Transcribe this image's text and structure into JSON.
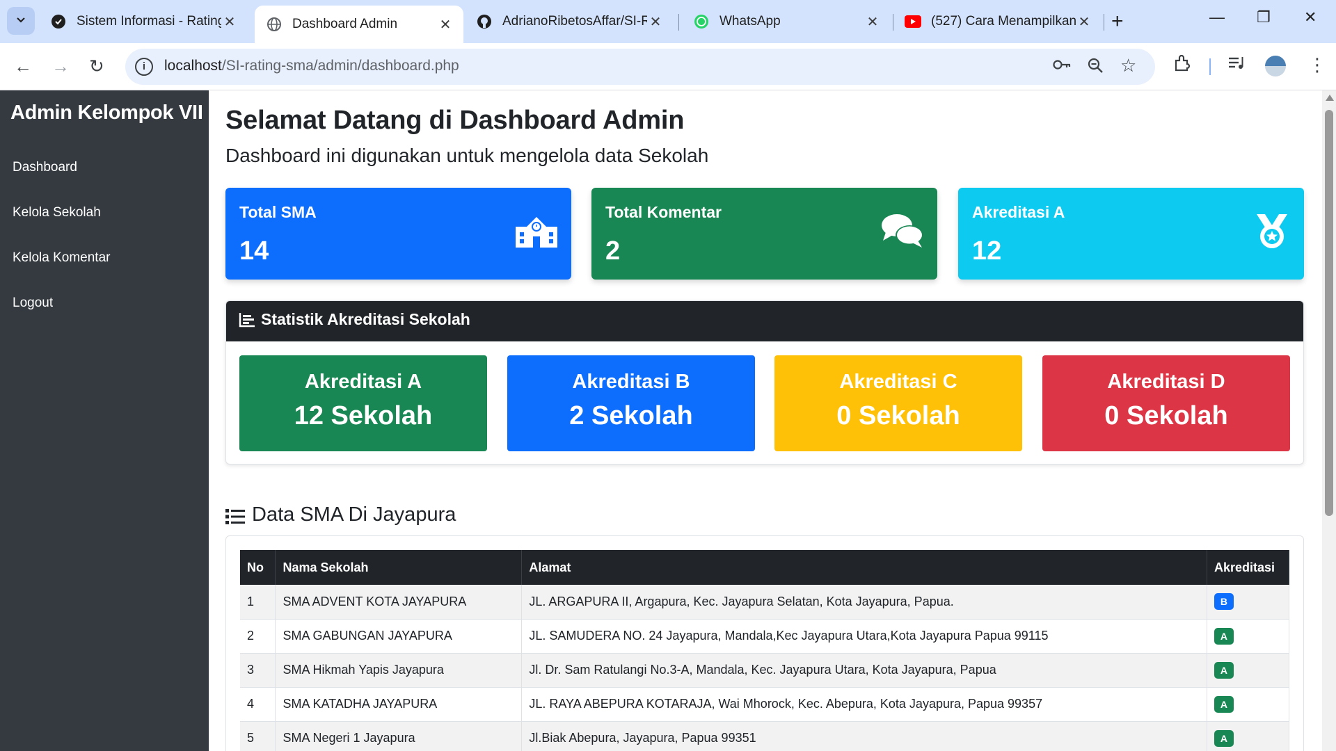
{
  "browser": {
    "tabs": [
      {
        "title": "Sistem Informasi - Rating",
        "active": false
      },
      {
        "title": "Dashboard Admin",
        "active": true
      },
      {
        "title": "AdrianoRibetosAffar/SI-R",
        "active": false
      },
      {
        "title": "WhatsApp",
        "active": false
      },
      {
        "title": "(527) Cara Menampilkan",
        "active": false
      }
    ],
    "url_host": "localhost",
    "url_path": "/SI-rating-sma/admin/dashboard.php"
  },
  "sidebar": {
    "brand": "Admin Kelompok VII",
    "items": [
      {
        "label": "Dashboard"
      },
      {
        "label": "Kelola Sekolah"
      },
      {
        "label": "Kelola Komentar"
      },
      {
        "label": "Logout"
      }
    ]
  },
  "main": {
    "title": "Selamat Datang di Dashboard Admin",
    "subtitle": "Dashboard ini digunakan untuk mengelola data Sekolah",
    "stats": [
      {
        "label": "Total SMA",
        "value": "14",
        "color": "#0d6efd",
        "icon": "school-icon"
      },
      {
        "label": "Total Komentar",
        "value": "2",
        "color": "#198754",
        "icon": "comments-icon"
      },
      {
        "label": "Akreditasi A",
        "value": "12",
        "color": "#0dcaf0",
        "icon": "medal-icon"
      }
    ],
    "statistik": {
      "title": "Statistik Akreditasi Sekolah",
      "boxes": [
        {
          "label": "Akreditasi A",
          "count": "12 Sekolah",
          "color": "#198754"
        },
        {
          "label": "Akreditasi B",
          "count": "2 Sekolah",
          "color": "#0d6efd"
        },
        {
          "label": "Akreditasi C",
          "count": "0 Sekolah",
          "color": "#ffc107"
        },
        {
          "label": "Akreditasi D",
          "count": "0 Sekolah",
          "color": "#dc3545"
        }
      ]
    },
    "data_sma": {
      "title": "Data SMA Di Jayapura",
      "headers": {
        "no": "No",
        "nama": "Nama Sekolah",
        "alamat": "Alamat",
        "akreditasi": "Akreditasi"
      },
      "rows": [
        {
          "no": "1",
          "nama": "SMA ADVENT KOTA JAYAPURA",
          "alamat": "JL. ARGAPURA II, Argapura, Kec. Jayapura Selatan, Kota Jayapura, Papua.",
          "akreditasi": "B"
        },
        {
          "no": "2",
          "nama": "SMA GABUNGAN JAYAPURA",
          "alamat": "JL. SAMUDERA NO. 24 Jayapura, Mandala,Kec Jayapura Utara,Kota Jayapura Papua 99115",
          "akreditasi": "A"
        },
        {
          "no": "3",
          "nama": "SMA Hikmah Yapis Jayapura",
          "alamat": "Jl. Dr. Sam Ratulangi No.3-A, Mandala, Kec. Jayapura Utara, Kota Jayapura, Papua",
          "akreditasi": "A"
        },
        {
          "no": "4",
          "nama": "SMA KATADHA JAYAPURA",
          "alamat": "JL. RAYA ABEPURA KOTARAJA, Wai Mhorock, Kec. Abepura, Kota Jayapura, Papua 99357",
          "akreditasi": "A"
        },
        {
          "no": "5",
          "nama": "SMA Negeri 1 Jayapura",
          "alamat": "Jl.Biak Abepura, Jayapura, Papua 99351",
          "akreditasi": "A"
        }
      ],
      "badge_colors": {
        "A": "#198754",
        "B": "#0d6efd",
        "C": "#ffc107",
        "D": "#dc3545"
      }
    }
  }
}
